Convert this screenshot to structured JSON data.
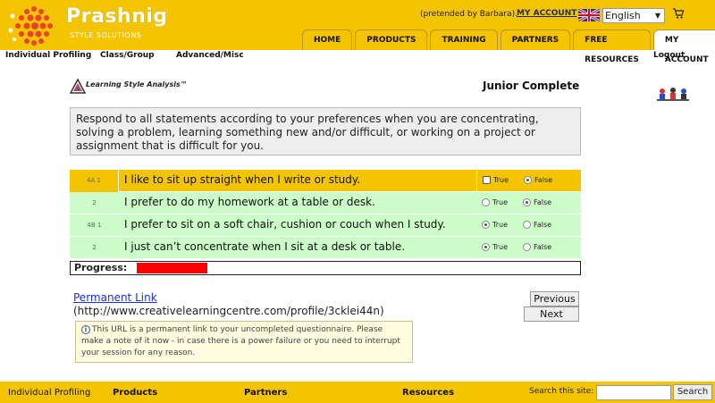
{
  "header": {
    "brand_name": "Prashnig",
    "brand_sub": "STYLE SOLUTIONS",
    "pretended": "(pretended by Barbara).",
    "my_account_link": "MY ACCOUNT",
    "language": "English",
    "tabs": [
      "HOME",
      "PRODUCTS",
      "TRAINING",
      "PARTNERS",
      "FREE RESOURCES",
      "MY ACCOUNT"
    ]
  },
  "subnav": {
    "items": [
      "Individual Profiling",
      "Class/Group",
      "Advanced/Misc"
    ],
    "logout": "Logout"
  },
  "content": {
    "lsa_logo_text": "Learning Style Analysis™",
    "page_title": "Junior Complete",
    "instructions": "Respond to all statements according to your preferences when you are concentrating, solving a problem, learning something new and/or difficult, or working on a project or assignment that is difficult for you.",
    "questions": [
      {
        "code": "4A 1",
        "text": "I like to sit up straight when I write or study.",
        "selected": "False",
        "active": true
      },
      {
        "code": "2",
        "text": "I prefer to do my homework at a table or desk.",
        "selected": "False",
        "active": false
      },
      {
        "code": "4B 1",
        "text": "I prefer to sit on a soft chair, cushion or couch when I study.",
        "selected": "True",
        "active": false
      },
      {
        "code": "2",
        "text": "I just can’t concentrate when I sit at a desk or table.",
        "selected": "True",
        "active": false
      }
    ],
    "true_label": "True",
    "false_label": "False",
    "progress_label": "Progress:",
    "progress_fraction": 0.16,
    "permanent_link": "Permanent Link",
    "permanent_url": "(http://www.creativelearningcentre.com/profile/3cklei44n)",
    "previous_label": "Previous",
    "next_label": "Next",
    "info_text": "This URL is a permanent link to your uncompleted questionnaire. Please make a note of it now - in case there is a power failure or you need to interrupt your session for any reason."
  },
  "footer": {
    "items": [
      "Individual Profiling",
      "Products",
      "Partners",
      "Resources"
    ],
    "search_label": "Search this site:",
    "search_button": "Search"
  },
  "colors": {
    "brand_yellow": "#f5c400",
    "row_green": "#ccfcc8",
    "progress_red": "#ff0000"
  }
}
